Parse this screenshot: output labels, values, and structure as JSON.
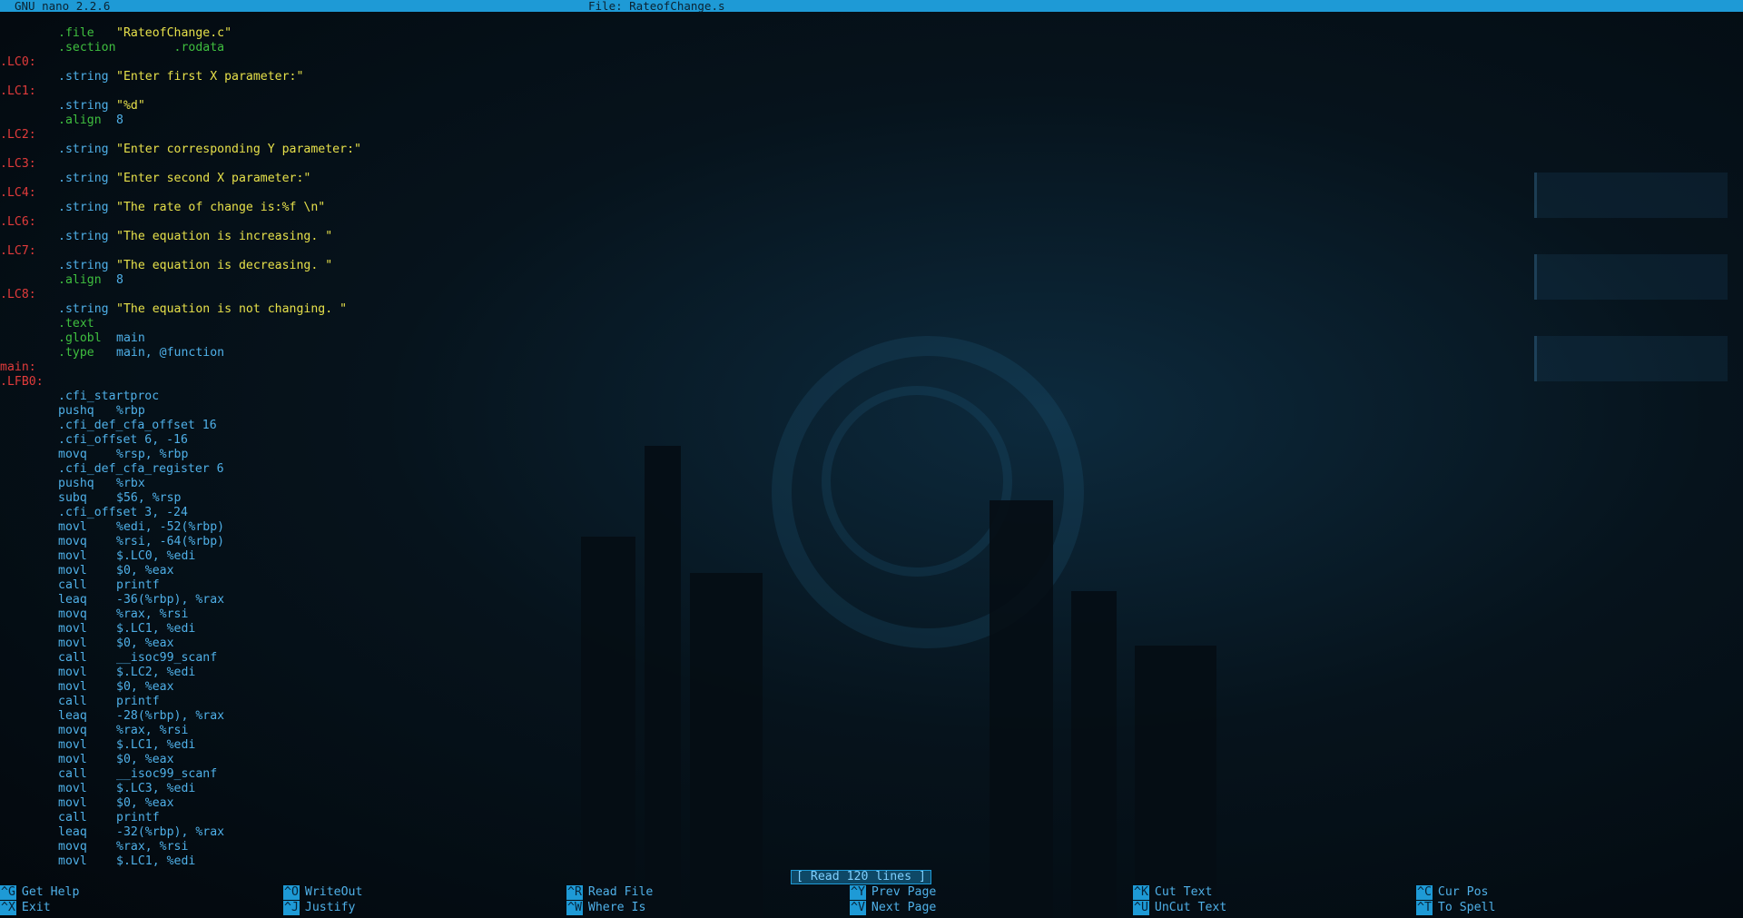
{
  "app": {
    "version": "GNU nano 2.2.6",
    "file_title": "File: RateofChange.s"
  },
  "lines": [
    {
      "c1": "",
      "c2": ".file",
      "c3": "\"RateofChange.c\"",
      "t2": "dir",
      "t3": "str"
    },
    {
      "c1": "",
      "c2": ".section",
      "c3": "        .rodata",
      "t2": "dir",
      "t3": "dir"
    },
    {
      "c1": ".LC0:",
      "c2": "",
      "c3": "",
      "t2": "",
      "t3": ""
    },
    {
      "c1": "",
      "c2": ".string",
      "c3": "\"Enter first X parameter:\"",
      "t2": "ins",
      "t3": "str"
    },
    {
      "c1": ".LC1:",
      "c2": "",
      "c3": "",
      "t2": "",
      "t3": ""
    },
    {
      "c1": "",
      "c2": ".string",
      "c3": "\"%d\"",
      "t2": "ins",
      "t3": "str"
    },
    {
      "c1": "",
      "c2": ".align",
      "c3": "8",
      "t2": "dir",
      "t3": "ins"
    },
    {
      "c1": ".LC2:",
      "c2": "",
      "c3": "",
      "t2": "",
      "t3": ""
    },
    {
      "c1": "",
      "c2": ".string",
      "c3": "\"Enter corresponding Y parameter:\"",
      "t2": "ins",
      "t3": "str"
    },
    {
      "c1": ".LC3:",
      "c2": "",
      "c3": "",
      "t2": "",
      "t3": ""
    },
    {
      "c1": "",
      "c2": ".string",
      "c3": "\"Enter second X parameter:\"",
      "t2": "ins",
      "t3": "str"
    },
    {
      "c1": ".LC4:",
      "c2": "",
      "c3": "",
      "t2": "",
      "t3": ""
    },
    {
      "c1": "",
      "c2": ".string",
      "c3": "\"The rate of change is:%f \\n\"",
      "t2": "ins",
      "t3": "str"
    },
    {
      "c1": ".LC6:",
      "c2": "",
      "c3": "",
      "t2": "",
      "t3": ""
    },
    {
      "c1": "",
      "c2": ".string",
      "c3": "\"The equation is increasing. \"",
      "t2": "ins",
      "t3": "str"
    },
    {
      "c1": ".LC7:",
      "c2": "",
      "c3": "",
      "t2": "",
      "t3": ""
    },
    {
      "c1": "",
      "c2": ".string",
      "c3": "\"The equation is decreasing. \"",
      "t2": "ins",
      "t3": "str"
    },
    {
      "c1": "",
      "c2": ".align",
      "c3": "8",
      "t2": "dir",
      "t3": "ins"
    },
    {
      "c1": ".LC8:",
      "c2": "",
      "c3": "",
      "t2": "",
      "t3": ""
    },
    {
      "c1": "",
      "c2": ".string",
      "c3": "\"The equation is not changing. \"",
      "t2": "ins",
      "t3": "str"
    },
    {
      "c1": "",
      "c2": ".text",
      "c3": "",
      "t2": "dir",
      "t3": ""
    },
    {
      "c1": "",
      "c2": ".globl",
      "c3": "main",
      "t2": "dir",
      "t3": "ins"
    },
    {
      "c1": "",
      "c2": ".type",
      "c3": "main, @function",
      "t2": "dir",
      "t3": "ins"
    },
    {
      "c1": "main:",
      "c2": "",
      "c3": "",
      "t2": "",
      "t3": ""
    },
    {
      "c1": ".LFB0:",
      "c2": "",
      "c3": "",
      "t2": "",
      "t3": ""
    },
    {
      "c1": "",
      "c2": ".cfi_startproc",
      "c3": "",
      "t2": "ins",
      "t3": ""
    },
    {
      "c1": "",
      "c2": "pushq",
      "c3": "%rbp",
      "t2": "ins",
      "t3": "ins"
    },
    {
      "c1": "",
      "c2": ".cfi_def_cfa_offset 16",
      "c3": "",
      "t2": "ins",
      "t3": ""
    },
    {
      "c1": "",
      "c2": ".cfi_offset 6, -16",
      "c3": "",
      "t2": "ins",
      "t3": ""
    },
    {
      "c1": "",
      "c2": "movq",
      "c3": "%rsp, %rbp",
      "t2": "ins",
      "t3": "ins"
    },
    {
      "c1": "",
      "c2": ".cfi_def_cfa_register 6",
      "c3": "",
      "t2": "ins",
      "t3": ""
    },
    {
      "c1": "",
      "c2": "pushq",
      "c3": "%rbx",
      "t2": "ins",
      "t3": "ins"
    },
    {
      "c1": "",
      "c2": "subq",
      "c3": "$56, %rsp",
      "t2": "ins",
      "t3": "ins"
    },
    {
      "c1": "",
      "c2": ".cfi_offset 3, -24",
      "c3": "",
      "t2": "ins",
      "t3": ""
    },
    {
      "c1": "",
      "c2": "movl",
      "c3": "%edi, -52(%rbp)",
      "t2": "ins",
      "t3": "ins"
    },
    {
      "c1": "",
      "c2": "movq",
      "c3": "%rsi, -64(%rbp)",
      "t2": "ins",
      "t3": "ins"
    },
    {
      "c1": "",
      "c2": "movl",
      "c3": "$.LC0, %edi",
      "t2": "ins",
      "t3": "ins"
    },
    {
      "c1": "",
      "c2": "movl",
      "c3": "$0, %eax",
      "t2": "ins",
      "t3": "ins"
    },
    {
      "c1": "",
      "c2": "call",
      "c3": "printf",
      "t2": "ins",
      "t3": "ins"
    },
    {
      "c1": "",
      "c2": "leaq",
      "c3": "-36(%rbp), %rax",
      "t2": "ins",
      "t3": "ins"
    },
    {
      "c1": "",
      "c2": "movq",
      "c3": "%rax, %rsi",
      "t2": "ins",
      "t3": "ins"
    },
    {
      "c1": "",
      "c2": "movl",
      "c3": "$.LC1, %edi",
      "t2": "ins",
      "t3": "ins"
    },
    {
      "c1": "",
      "c2": "movl",
      "c3": "$0, %eax",
      "t2": "ins",
      "t3": "ins"
    },
    {
      "c1": "",
      "c2": "call",
      "c3": "__isoc99_scanf",
      "t2": "ins",
      "t3": "ins"
    },
    {
      "c1": "",
      "c2": "movl",
      "c3": "$.LC2, %edi",
      "t2": "ins",
      "t3": "ins"
    },
    {
      "c1": "",
      "c2": "movl",
      "c3": "$0, %eax",
      "t2": "ins",
      "t3": "ins"
    },
    {
      "c1": "",
      "c2": "call",
      "c3": "printf",
      "t2": "ins",
      "t3": "ins"
    },
    {
      "c1": "",
      "c2": "leaq",
      "c3": "-28(%rbp), %rax",
      "t2": "ins",
      "t3": "ins"
    },
    {
      "c1": "",
      "c2": "movq",
      "c3": "%rax, %rsi",
      "t2": "ins",
      "t3": "ins"
    },
    {
      "c1": "",
      "c2": "movl",
      "c3": "$.LC1, %edi",
      "t2": "ins",
      "t3": "ins"
    },
    {
      "c1": "",
      "c2": "movl",
      "c3": "$0, %eax",
      "t2": "ins",
      "t3": "ins"
    },
    {
      "c1": "",
      "c2": "call",
      "c3": "__isoc99_scanf",
      "t2": "ins",
      "t3": "ins"
    },
    {
      "c1": "",
      "c2": "movl",
      "c3": "$.LC3, %edi",
      "t2": "ins",
      "t3": "ins"
    },
    {
      "c1": "",
      "c2": "movl",
      "c3": "$0, %eax",
      "t2": "ins",
      "t3": "ins"
    },
    {
      "c1": "",
      "c2": "call",
      "c3": "printf",
      "t2": "ins",
      "t3": "ins"
    },
    {
      "c1": "",
      "c2": "leaq",
      "c3": "-32(%rbp), %rax",
      "t2": "ins",
      "t3": "ins"
    },
    {
      "c1": "",
      "c2": "movq",
      "c3": "%rax, %rsi",
      "t2": "ins",
      "t3": "ins"
    },
    {
      "c1": "",
      "c2": "movl",
      "c3": "$.LC1, %edi",
      "t2": "ins",
      "t3": "ins"
    }
  ],
  "status": "[ Read 120 lines ]",
  "shortcuts": [
    {
      "key": "^G",
      "label": "Get Help"
    },
    {
      "key": "^X",
      "label": "Exit"
    },
    {
      "key": "^O",
      "label": "WriteOut"
    },
    {
      "key": "^J",
      "label": "Justify"
    },
    {
      "key": "^R",
      "label": "Read File"
    },
    {
      "key": "^W",
      "label": "Where Is"
    },
    {
      "key": "^Y",
      "label": "Prev Page"
    },
    {
      "key": "^V",
      "label": "Next Page"
    },
    {
      "key": "^K",
      "label": "Cut Text"
    },
    {
      "key": "^U",
      "label": "UnCut Text"
    },
    {
      "key": "^C",
      "label": "Cur Pos"
    },
    {
      "key": "^T",
      "label": "To Spell"
    }
  ],
  "colors": {
    "accent": "#1e9ad6",
    "label": "#e23b3b",
    "directive": "#3fbf3f",
    "string": "#e6e04a",
    "instruction": "#4fb0e8"
  }
}
